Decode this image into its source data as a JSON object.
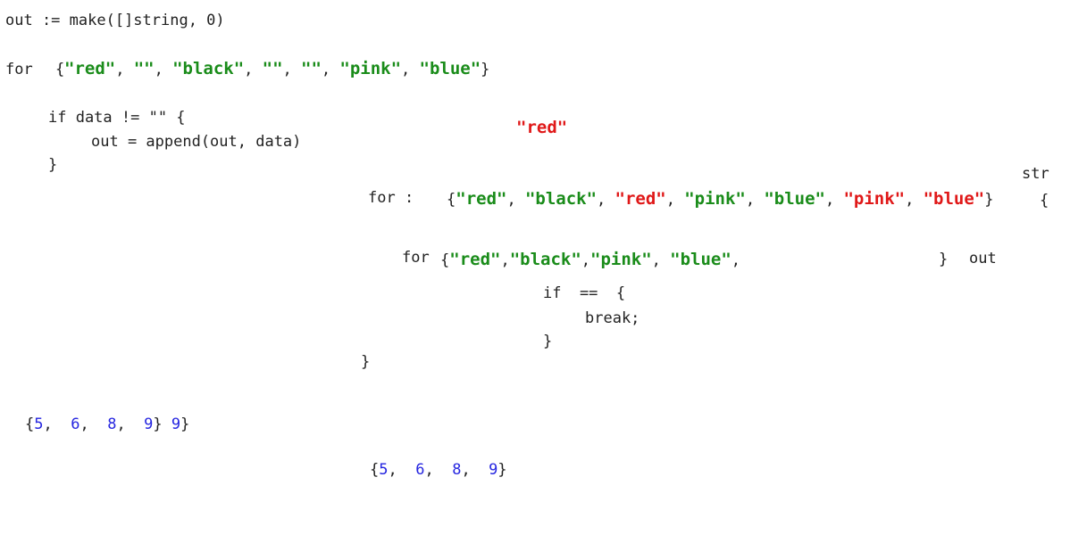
{
  "left": {
    "line_make": "out := make([]string, 0)",
    "line_for_kw": "for",
    "line_for_open": "{",
    "line_for_items": [
      {
        "t": "\"red\"",
        "sep": ", "
      },
      {
        "t": "\"\"",
        "sep": ", "
      },
      {
        "t": "\"black\"",
        "sep": ", "
      },
      {
        "t": "\"\"",
        "sep": ", "
      },
      {
        "t": "\"\"",
        "sep": ", "
      },
      {
        "t": "\"pink\"",
        "sep": ", "
      },
      {
        "t": "\"blue\"",
        "sep": ""
      }
    ],
    "line_for_close": "}",
    "if_line": "if data != \"\" {",
    "append_line": "out = append(out, data)",
    "close_brace": "}",
    "nums_open": "{",
    "nums": [
      "5",
      "6",
      "8",
      "9"
    ],
    "nums_close": "}",
    "nums_extra": "9}"
  },
  "right": {
    "floating_red": "\"red\"",
    "str_label": "str",
    "outer_for": "for :",
    "outer_open": "{",
    "outer_items": [
      {
        "t": "\"red\"",
        "c": "g"
      },
      {
        "t": "\"black\"",
        "c": "g"
      },
      {
        "t": "\"red\"",
        "c": "r"
      },
      {
        "t": "\"pink\"",
        "c": "g"
      },
      {
        "t": "\"blue\"",
        "c": "g"
      },
      {
        "t": "\"pink\"",
        "c": "r"
      },
      {
        "t": "\"blue\"",
        "c": "r"
      }
    ],
    "outer_close": "}",
    "outer_brace": "{",
    "inner_for": "for",
    "inner_open": "{",
    "inner_items": [
      "\"red\"",
      "\"black\"",
      "\"pink\"",
      "\"blue\""
    ],
    "inner_close": "}",
    "inner_out": "out",
    "if_line": "if  ==  {",
    "break_line": "break;",
    "if_close": "}",
    "outer_end": "}",
    "nums_open": "{",
    "nums": [
      "5",
      "6",
      "8",
      "9"
    ],
    "nums_close": "}"
  }
}
